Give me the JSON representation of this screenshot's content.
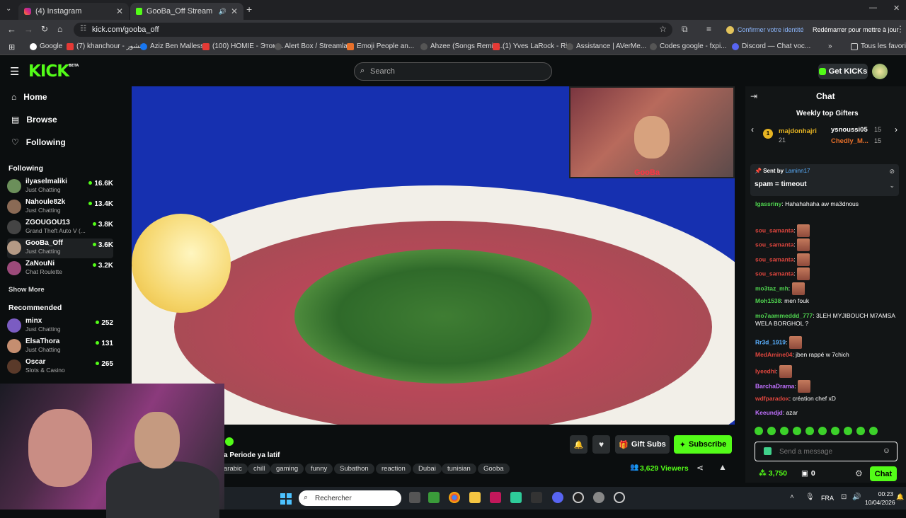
{
  "browser": {
    "tabs": [
      {
        "label": "(4) Instagram",
        "active": false
      },
      {
        "label": "GooBa_Off Stream - Watch",
        "active": true
      }
    ],
    "url": "kick.com/gooba_off",
    "profile_notice": "Confirmer votre identité",
    "restart_label": "Redémarrer pour mettre à jour",
    "bookmarks": [
      "Google",
      "(7) khanchour - خنشور",
      "Aziz Ben Mallessa",
      "(100) HOMIE - Этом...",
      "Alert Box / Streamla...",
      "Emoji People an...",
      "Ahzee (Songs Remix...",
      "(1) Yves LaRock - Ri...",
      "Assistance | AVerMe...",
      "Codes google - fxpi...",
      "Discord — Chat voc...",
      "Tous les favoris"
    ]
  },
  "header": {
    "logo": "KICK",
    "logo_badge": "BETA",
    "search_placeholder": "Search",
    "get_kicks": "Get KICKs"
  },
  "sidebar": {
    "nav": [
      "Home",
      "Browse",
      "Following"
    ],
    "following_title": "Following",
    "following": [
      {
        "name": "ilyaselmaliki",
        "category": "Just Chatting",
        "viewers": "16.6K"
      },
      {
        "name": "Nahoule82k",
        "category": "Just Chatting",
        "viewers": "13.4K"
      },
      {
        "name": "ZGOUGOU13",
        "category": "Grand Theft Auto V (...",
        "viewers": "3.8K"
      },
      {
        "name": "GooBa_Off",
        "category": "Just Chatting",
        "viewers": "3.6K"
      },
      {
        "name": "ZaNouNi",
        "category": "Chat Roulette",
        "viewers": "3.2K"
      }
    ],
    "show_more": "Show More",
    "recommended_title": "Recommended",
    "recommended": [
      {
        "name": "minx",
        "category": "Just Chatting",
        "viewers": "252"
      },
      {
        "name": "ElsaThora",
        "category": "Just Chatting",
        "viewers": "131"
      },
      {
        "name": "Oscar",
        "category": "Slots & Casino",
        "viewers": "265"
      }
    ]
  },
  "video": {
    "cam_brand": "GooBa"
  },
  "stream": {
    "title": "a Periode ya latif",
    "tags": [
      "arabic",
      "chill",
      "gaming",
      "funny",
      "Subathon",
      "reaction",
      "Dubai",
      "tunisian",
      "Gooba"
    ],
    "gift_subs": "Gift Subs",
    "subscribe": "Subscribe",
    "viewers": "3,629 Viewers"
  },
  "chat": {
    "title": "Chat",
    "gifters_title": "Weekly top Gifters",
    "gifters": [
      {
        "rank": "1",
        "name": "majdonhajri",
        "count": "21"
      },
      {
        "name": "ysnoussi05",
        "count": "15"
      },
      {
        "name": "Chedly_M...",
        "count": "15"
      }
    ],
    "pinned_by_label": "Sent by",
    "pinned_by": "Laminn17",
    "pinned_text": "spam = timeout",
    "messages": [
      {
        "user": "lgassriny",
        "color": "#4fd44f",
        "text": "Hahahahaha aw ma3dnous"
      },
      {
        "user": "sou_samanta",
        "color": "#e0463e",
        "text": ""
      },
      {
        "user": "sou_samanta",
        "color": "#e0463e",
        "text": ""
      },
      {
        "user": "sou_samanta",
        "color": "#e0463e",
        "text": ""
      },
      {
        "user": "sou_samanta",
        "color": "#e0463e",
        "text": ""
      },
      {
        "user": "mo3taz_mh",
        "color": "#4fd44f",
        "text": ""
      },
      {
        "user": "Moh1538",
        "color": "#4fd44f",
        "text": "men fouk"
      },
      {
        "user": "mo7aammeddd_777",
        "color": "#4fd44f",
        "text": "3LEH MYJIBOUCH M7AMSA WELA BORGHOL ?"
      },
      {
        "user": "Rr3d_1919",
        "color": "#5ab0ff",
        "text": ""
      },
      {
        "user": "MedAmine04",
        "color": "#e0463e",
        "text": "jben rappé w 7chich"
      },
      {
        "user": "Iyeedhi",
        "color": "#e0463e",
        "text": ""
      },
      {
        "user": "BarchaDrama",
        "color": "#c070ff",
        "text": ""
      },
      {
        "user": "wdfparadox",
        "color": "#e0463e",
        "text": "création chef xD"
      },
      {
        "user": "Keeundjd",
        "color": "#c070ff",
        "text": "azar"
      }
    ],
    "input_placeholder": "Send a message",
    "points": "3,750",
    "zero": "0",
    "send": "Chat"
  },
  "taskbar": {
    "search": "Rechercher",
    "lang": "FRA",
    "time": "00:23",
    "date": "10/04/2026"
  }
}
